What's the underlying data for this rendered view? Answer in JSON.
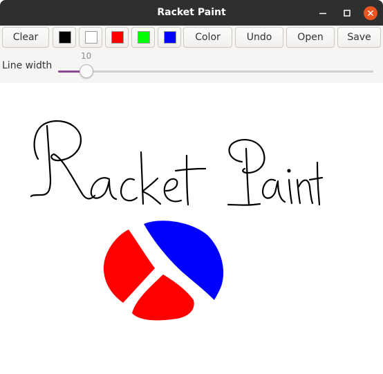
{
  "window": {
    "title": "Racket Paint"
  },
  "toolbar": {
    "clear_label": "Clear",
    "color_label": "Color",
    "undo_label": "Undo",
    "open_label": "Open",
    "save_label": "Save",
    "swatches": [
      "#000000",
      "#ffffff",
      "#ff0000",
      "#00ff00",
      "#0000ff"
    ]
  },
  "line_width": {
    "label": "Line width",
    "value": "10",
    "min": 1,
    "max": 100,
    "fill_color": "#8c4a95"
  },
  "canvas": {
    "background": "#ffffff",
    "stroke_colors": {
      "text": "#000000",
      "left_shape": "#ff0000",
      "right_shape": "#0000ff"
    }
  }
}
